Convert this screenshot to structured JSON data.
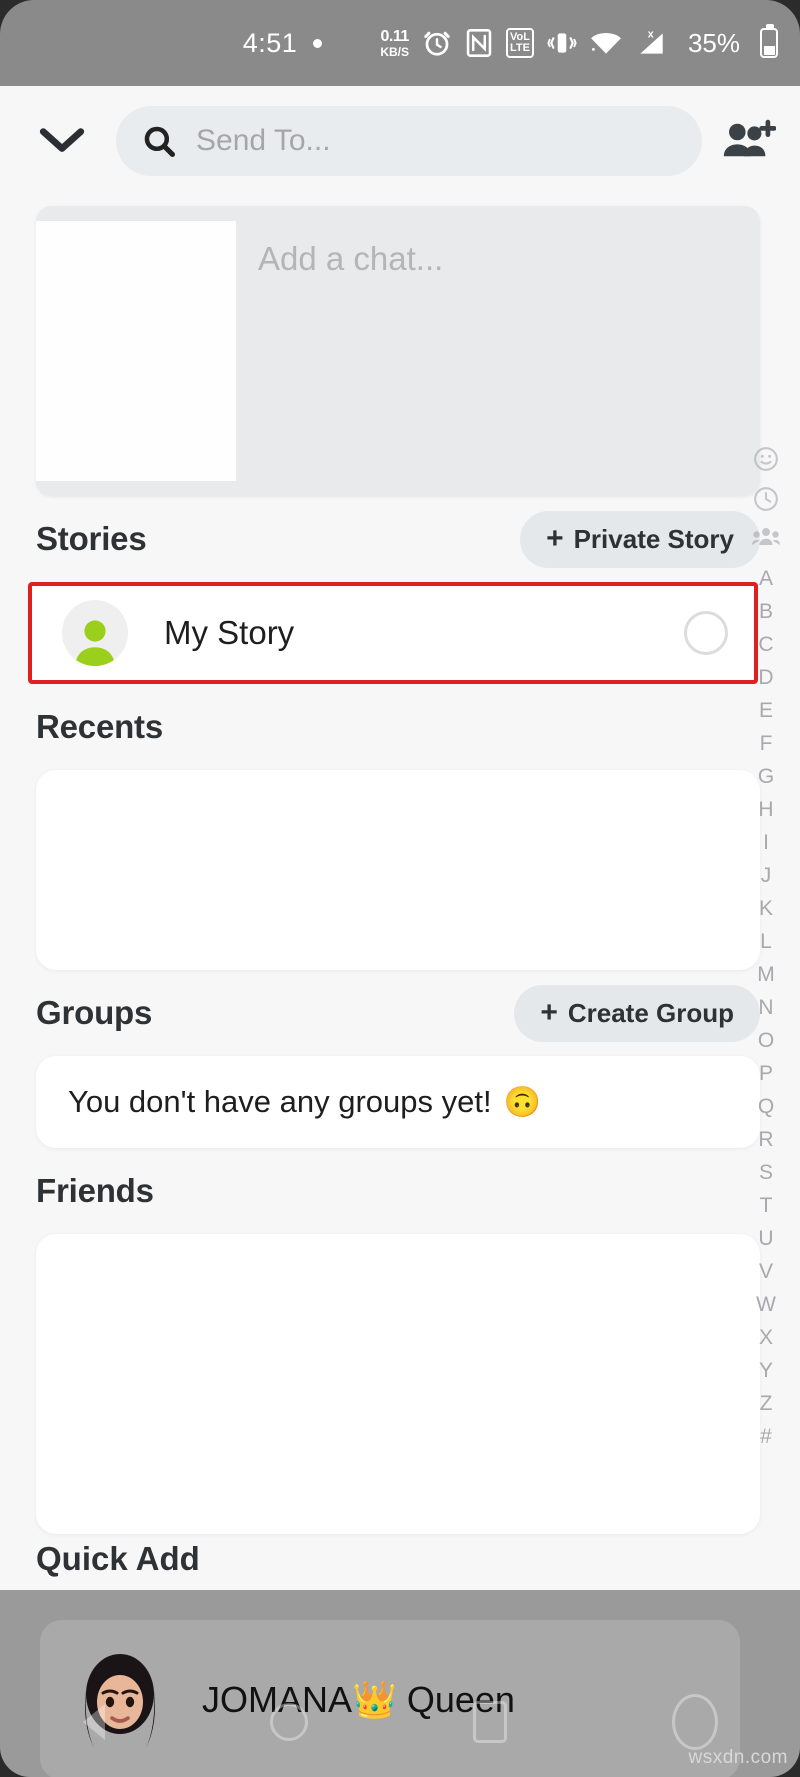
{
  "status_bar": {
    "time": "4:51",
    "data_rate": "0.11",
    "data_unit": "KB/S",
    "alarm_icon": "alarm-clock-icon",
    "nfc_icon": "nfc-icon",
    "volte_top": "VoL",
    "volte_bottom": "LTE",
    "vibrate_icon": "vibrate-icon",
    "wifi_icon": "wifi-icon",
    "signal_icon": "no-sim-signal-icon",
    "signal_badge": "x",
    "battery_percent": "35%",
    "battery_icon": "battery-icon"
  },
  "topbar": {
    "chevron_icon": "chevron-down-icon",
    "search_icon": "search-icon",
    "search_placeholder": "Send To...",
    "add_friends_icon": "add-friends-icon"
  },
  "chat_card": {
    "placeholder": "Add a chat..."
  },
  "stories": {
    "title": "Stories",
    "private_story_button": "Private Story",
    "plus": "+",
    "my_story": {
      "name": "My Story",
      "avatar_icon": "person-avatar-icon",
      "selected": false,
      "highlighted": true,
      "highlight_color": "#e02020"
    }
  },
  "recents": {
    "title": "Recents",
    "items": []
  },
  "groups": {
    "title": "Groups",
    "create_group_button": "Create Group",
    "plus": "+",
    "empty_message": "You don't have any groups yet!",
    "empty_emoji": "🙃"
  },
  "friends": {
    "title": "Friends",
    "items": []
  },
  "quick_add": {
    "title": "Quick Add",
    "items": [
      {
        "name": "JOMANA👑 Queen",
        "avatar_icon": "bitmoji-avatar-icon"
      }
    ]
  },
  "alpha_index": {
    "icons": [
      "smiley-icon",
      "clock-icon",
      "group-icon"
    ],
    "letters": [
      "A",
      "B",
      "C",
      "D",
      "E",
      "F",
      "G",
      "H",
      "I",
      "J",
      "K",
      "L",
      "M",
      "N",
      "O",
      "P",
      "Q",
      "R",
      "S",
      "T",
      "U",
      "V",
      "W",
      "X",
      "Y",
      "Z",
      "#"
    ]
  },
  "nav_bar": {
    "back_icon": "nav-back-icon",
    "home_icon": "nav-home-icon",
    "recents_icon": "nav-recents-icon",
    "circle_icon": "nav-circle-icon"
  },
  "watermark": "wsxdn.com",
  "colors": {
    "accent_green": "#9ad01c",
    "highlight_red": "#e02020",
    "app_bg": "#f7f7f8",
    "pill_bg": "#e4e8ea",
    "status_bar_bg": "#8a8a8a"
  }
}
